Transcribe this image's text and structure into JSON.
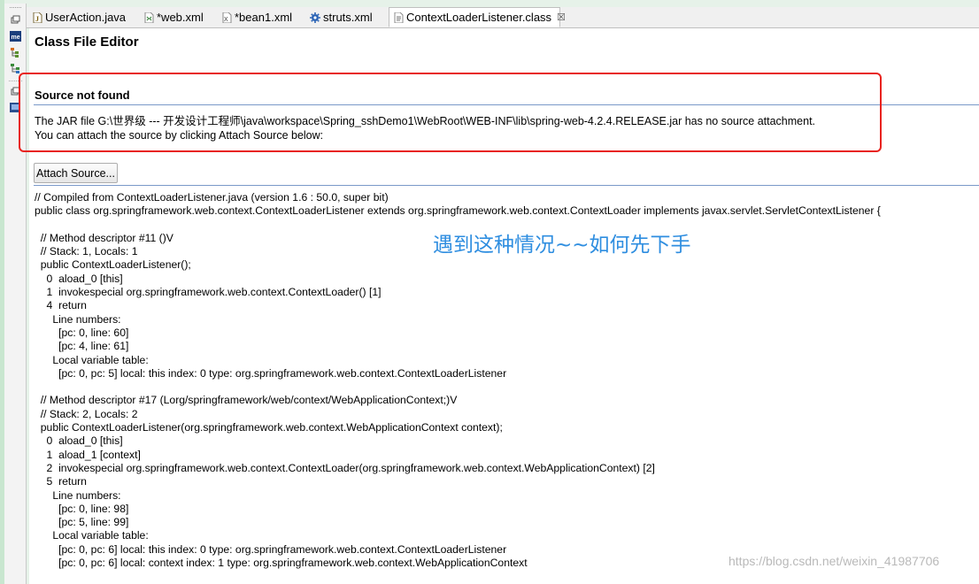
{
  "tabs": [
    {
      "label": "UserAction.java",
      "icon": "java-file-icon",
      "dirty": false
    },
    {
      "label": "*web.xml",
      "icon": "xml-file-icon",
      "dirty": true
    },
    {
      "label": "*bean1.xml",
      "icon": "xml-file-icon",
      "dirty": true
    },
    {
      "label": "struts.xml",
      "icon": "gear-icon",
      "dirty": false
    },
    {
      "label": "ContextLoaderListener.class",
      "icon": "class-file-icon",
      "dirty": false,
      "active": true,
      "close": "☒"
    }
  ],
  "editor": {
    "title": "Class File Editor",
    "source_not_found": "Source not found",
    "jar_message": "The JAR file G:\\世界级 --- 开发设计工程师\\java\\workspace\\Spring_sshDemo1\\WebRoot\\WEB-INF\\lib\\spring-web-4.2.4.RELEASE.jar has no source attachment.",
    "attach_message": "You can attach the source by clicking Attach Source below:",
    "attach_button": "Attach Source...",
    "code_lines": [
      "// Compiled from ContextLoaderListener.java (version 1.6 : 50.0, super bit)",
      "public class org.springframework.web.context.ContextLoaderListener extends org.springframework.web.context.ContextLoader implements javax.servlet.ServletContextListener {",
      "",
      "  // Method descriptor #11 ()V",
      "  // Stack: 1, Locals: 1",
      "  public ContextLoaderListener();",
      "    0  aload_0 [this]",
      "    1  invokespecial org.springframework.web.context.ContextLoader() [1]",
      "    4  return",
      "      Line numbers:",
      "        [pc: 0, line: 60]",
      "        [pc: 4, line: 61]",
      "      Local variable table:",
      "        [pc: 0, pc: 5] local: this index: 0 type: org.springframework.web.context.ContextLoaderListener",
      "",
      "  // Method descriptor #17 (Lorg/springframework/web/context/WebApplicationContext;)V",
      "  // Stack: 2, Locals: 2",
      "  public ContextLoaderListener(org.springframework.web.context.WebApplicationContext context);",
      "    0  aload_0 [this]",
      "    1  aload_1 [context]",
      "    2  invokespecial org.springframework.web.context.ContextLoader(org.springframework.web.context.WebApplicationContext) [2]",
      "    5  return",
      "      Line numbers:",
      "        [pc: 0, line: 98]",
      "        [pc: 5, line: 99]",
      "      Local variable table:",
      "        [pc: 0, pc: 6] local: this index: 0 type: org.springframework.web.context.ContextLoaderListener",
      "        [pc: 0, pc: 6] local: context index: 1 type: org.springframework.web.context.WebApplicationContext"
    ]
  },
  "annotation": "遇到这种情况~~如何先下手",
  "watermark": "https://blog.csdn.net/weixin_41987706",
  "colors": {
    "highlight_box": "#e8231e",
    "annotation": "#2f8ee0"
  }
}
